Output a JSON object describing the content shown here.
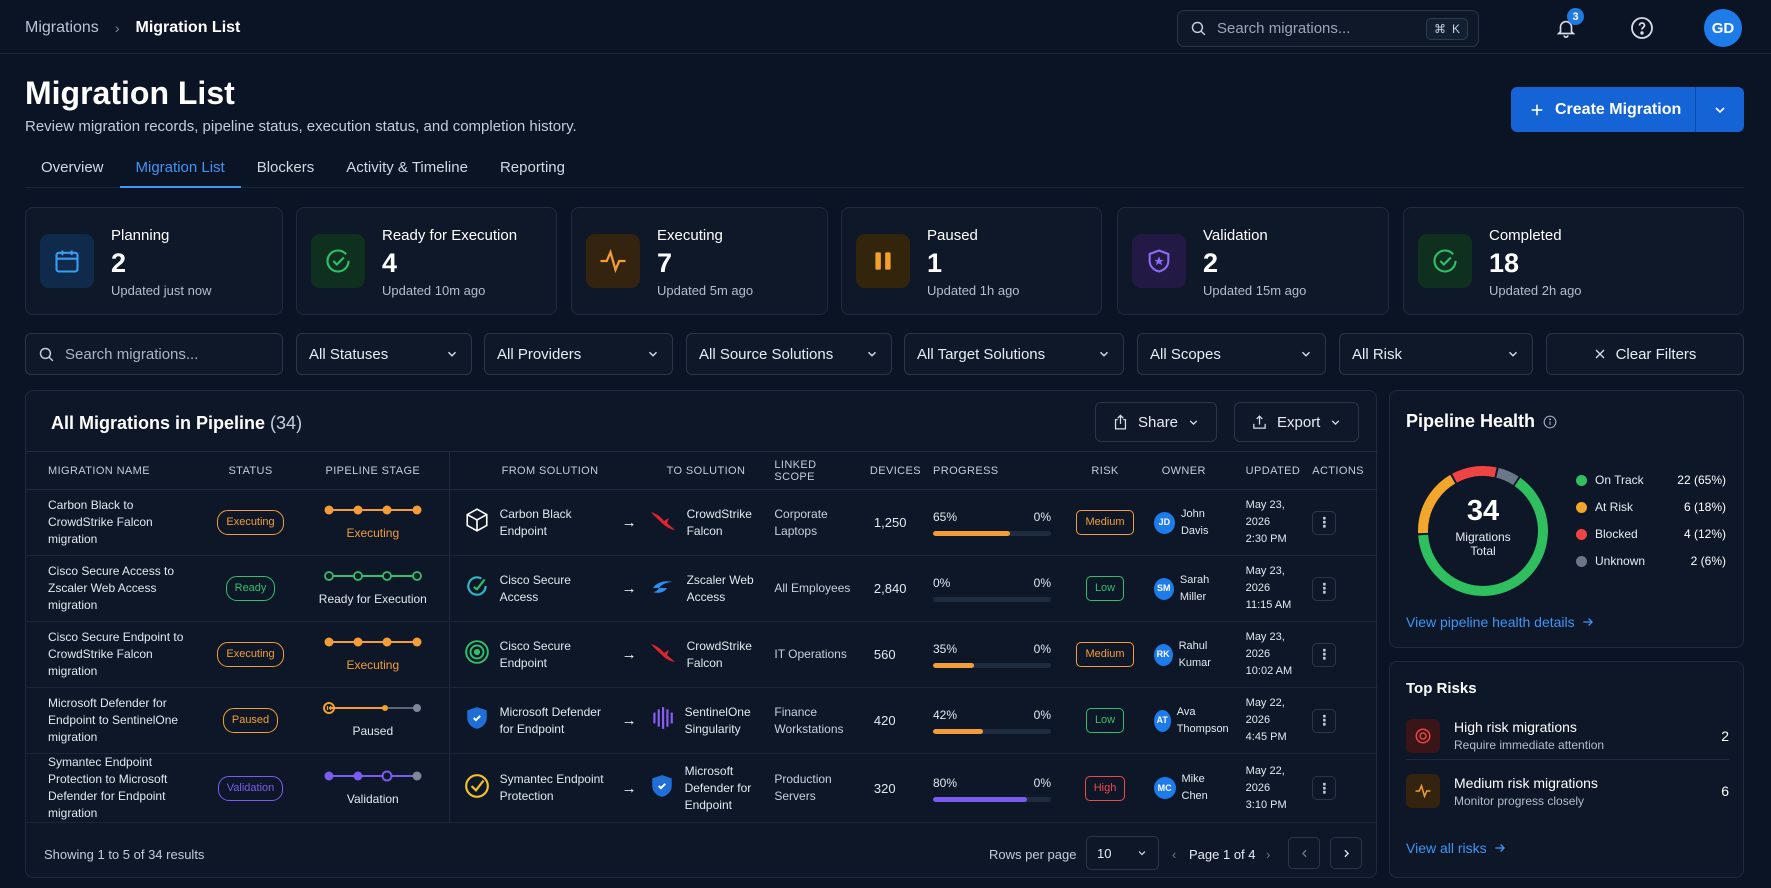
{
  "breadcrumb": {
    "root": "Migrations",
    "current": "Migration List"
  },
  "search": {
    "placeholder": "Search migrations...",
    "shortcut_mod": "⌘",
    "shortcut_key": "K"
  },
  "notifications": {
    "count": "3"
  },
  "user": {
    "initials": "GD"
  },
  "page": {
    "title": "Migration List",
    "subtitle": "Review migration records, pipeline status, execution status, and completion history."
  },
  "create_button": {
    "label": "Create Migration"
  },
  "tabs": [
    {
      "label": "Overview",
      "active": false
    },
    {
      "label": "Migration List",
      "active": true
    },
    {
      "label": "Blockers",
      "active": false
    },
    {
      "label": "Activity & Timeline",
      "active": false
    },
    {
      "label": "Reporting",
      "active": false
    }
  ],
  "stats": [
    {
      "label": "Planning",
      "value": "2",
      "updated": "Updated just now",
      "color": "#3b9cf0"
    },
    {
      "label": "Ready for Execution",
      "value": "4",
      "updated": "Updated 10m ago",
      "color": "#31c06a"
    },
    {
      "label": "Executing",
      "value": "7",
      "updated": "Updated 5m ago",
      "color": "#f29d38"
    },
    {
      "label": "Paused",
      "value": "1",
      "updated": "Updated 1h ago",
      "color": "#f2a22c"
    },
    {
      "label": "Validation",
      "value": "2",
      "updated": "Updated 15m ago",
      "color": "#7a5cf0"
    },
    {
      "label": "Completed",
      "value": "18",
      "updated": "Updated 2h ago",
      "color": "#31c06a"
    }
  ],
  "filters": {
    "search_placeholder": "Search migrations...",
    "statuses": "All Statuses",
    "providers": "All Providers",
    "source": "All Source Solutions",
    "target": "All Target Solutions",
    "scopes": "All Scopes",
    "risk": "All Risk",
    "clear": "Clear Filters"
  },
  "table": {
    "title": "All Migrations in Pipeline",
    "count": "(34)",
    "share": "Share",
    "export": "Export",
    "headers": [
      "MIGRATION NAME",
      "STATUS",
      "PIPELINE STAGE",
      "FROM SOLUTION",
      "TO SOLUTION",
      "LINKED SCOPE",
      "DEVICES",
      "PROGRESS",
      "RISK",
      "OWNER",
      "UPDATED",
      "ACTIONS"
    ],
    "rows": [
      {
        "name": "Carbon Black to CrowdStrike Falcon migration",
        "status": "Executing",
        "status_color": "#f29d38",
        "stage": "Executing",
        "stage_color": "#f29d38",
        "stage_done": 4,
        "from": "Carbon Black Endpoint",
        "to": "CrowdStrike Falcon",
        "scope": "Corporate Laptops",
        "devices": "1,250",
        "progress": "65%",
        "progress_value": 65,
        "progress_secondary": "0%",
        "bar_color": "#f29d38",
        "risk": "Medium",
        "risk_color": "#f29d38",
        "owner_initials": "JD",
        "owner": "John Davis",
        "updated_date": "May 23, 2026",
        "updated_time": "2:30 PM"
      },
      {
        "name": "Cisco Secure Access to Zscaler Web Access migration",
        "status": "Ready",
        "status_color": "#31c06a",
        "stage": "Ready for Execution",
        "stage_color": "#31c06a",
        "stage_done": 0,
        "from": "Cisco Secure Access",
        "to": "Zscaler Web Access",
        "scope": "All Employees",
        "devices": "2,840",
        "progress": "0%",
        "progress_value": 0,
        "progress_secondary": "0%",
        "bar_color": "#31c06a",
        "risk": "Low",
        "risk_color": "#31c06a",
        "owner_initials": "SM",
        "owner": "Sarah Miller",
        "updated_date": "May 23, 2026",
        "updated_time": "11:15 AM"
      },
      {
        "name": "Cisco Secure Endpoint to CrowdStrike Falcon migration",
        "status": "Executing",
        "status_color": "#f29d38",
        "stage": "Executing",
        "stage_color": "#f29d38",
        "stage_done": 4,
        "from": "Cisco Secure Endpoint",
        "to": "CrowdStrike Falcon",
        "scope": "IT Operations",
        "devices": "560",
        "progress": "35%",
        "progress_value": 35,
        "progress_secondary": "0%",
        "bar_color": "#f29d38",
        "risk": "Medium",
        "risk_color": "#f29d38",
        "owner_initials": "RK",
        "owner": "Rahul Kumar",
        "updated_date": "May 23, 2026",
        "updated_time": "10:02 AM"
      },
      {
        "name": "Microsoft Defender for Endpoint to SentinelOne migration",
        "status": "Paused",
        "status_color": "#f2a22c",
        "stage": "Paused",
        "stage_color": "#f2a22c",
        "stage_done": 2,
        "from": "Microsoft Defender for Endpoint",
        "to": "SentinelOne Singularity",
        "scope": "Finance Workstations",
        "devices": "420",
        "progress": "42%",
        "progress_value": 42,
        "progress_secondary": "0%",
        "bar_color": "#f29d38",
        "risk": "Low",
        "risk_color": "#31c06a",
        "owner_initials": "AT",
        "owner": "Ava Thompson",
        "updated_date": "May 22, 2026",
        "updated_time": "4:45 PM"
      },
      {
        "name": "Symantec Endpoint Protection to Microsoft Defender for Endpoint migration",
        "status": "Validation",
        "status_color": "#7a5cf0",
        "stage": "Validation",
        "stage_color": "#7a5cf0",
        "stage_done": 4,
        "from": "Symantec Endpoint Protection",
        "to": "Microsoft Defender for Endpoint",
        "scope": "Production Servers",
        "devices": "320",
        "progress": "80%",
        "progress_value": 80,
        "progress_secondary": "0%",
        "bar_color": "#7a5cf0",
        "risk": "High",
        "risk_color": "#ef4a4a",
        "owner_initials": "MC",
        "owner": "Mike Chen",
        "updated_date": "May 22, 2026",
        "updated_time": "3:10 PM"
      }
    ],
    "showing": "Showing 1 to 5 of 34 results",
    "rows_per_page_label": "Rows per page",
    "rows_per_page": "10",
    "page_label": "Page 1 of 4"
  },
  "pipeline_health": {
    "title": "Pipeline Health",
    "total": "34",
    "total_label_1": "Migrations",
    "total_label_2": "Total",
    "segments": [
      {
        "label": "On Track",
        "value": 22,
        "display": "22 (65%)",
        "color": "#2fbf5f"
      },
      {
        "label": "At Risk",
        "value": 6,
        "display": "6 (18%)",
        "color": "#f2a62c"
      },
      {
        "label": "Blocked",
        "value": 4,
        "display": "4 (12%)",
        "color": "#ef4444"
      },
      {
        "label": "Unknown",
        "value": 2,
        "display": "2 (6%)",
        "color": "#6b7688"
      }
    ],
    "link": "View pipeline health details"
  },
  "top_risks": {
    "title": "Top Risks",
    "items": [
      {
        "title": "High risk migrations",
        "subtitle": "Require immediate attention",
        "count": "2",
        "color": "#ef4444"
      },
      {
        "title": "Medium risk migrations",
        "subtitle": "Monitor progress closely",
        "count": "6",
        "color": "#f29d38"
      }
    ],
    "link": "View all risks"
  }
}
